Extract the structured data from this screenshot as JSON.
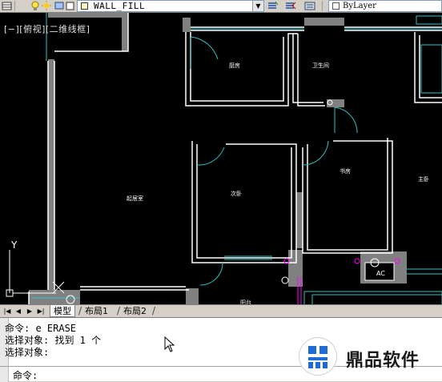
{
  "toolbar": {
    "layer_name": "WALL_FILL",
    "linetype_value": "ByLayer"
  },
  "viewport": {
    "label": "[−][俯视][二维线框]"
  },
  "rooms": {
    "kitchen": "厨房",
    "bathroom": "卫生间",
    "living": "起居室",
    "bedroom1": "次卧",
    "bedroom2": "书房",
    "bedroom3": "主卧",
    "bottom": "阳台",
    "ac": "AC"
  },
  "ucs": {
    "y": "Y"
  },
  "tabs": {
    "model": "模型",
    "layout1": "布局1",
    "layout2": "布局2"
  },
  "command": {
    "history": [
      "命令: e ERASE",
      "选择对象: 找到 1 个",
      "选择对象:"
    ],
    "prompt": "命令:",
    "input_value": "",
    "input_placeholder": ""
  },
  "watermark": {
    "text": "鼎品软件"
  },
  "colors": {
    "wall": "#ffffff",
    "fill": "#808080",
    "cyan": "#2ec4c4",
    "magenta": "#ff00ff",
    "background": "#000000"
  }
}
